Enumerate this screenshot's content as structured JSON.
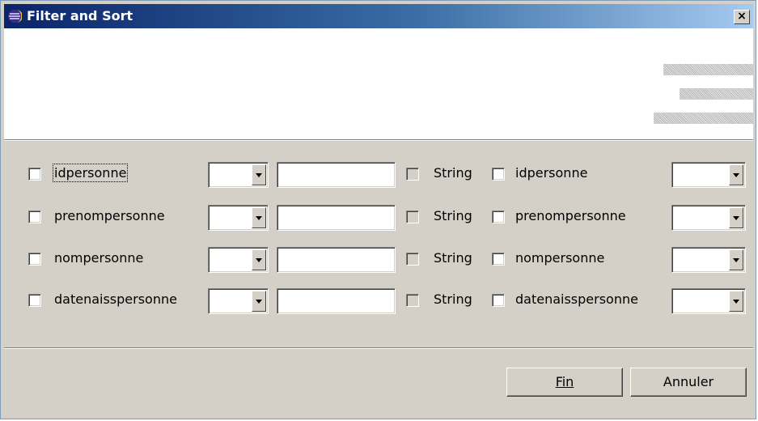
{
  "window": {
    "title": "Filter and Sort",
    "close_glyph": "×"
  },
  "rows": [
    {
      "left_label": "idpersonne",
      "type_label": "String",
      "right_label": "idpersonne"
    },
    {
      "left_label": "prenompersonne",
      "type_label": "String",
      "right_label": "prenompersonne"
    },
    {
      "left_label": "nompersonne",
      "type_label": "String",
      "right_label": "nompersonne"
    },
    {
      "left_label": "datenaisspersonne",
      "type_label": "String",
      "right_label": "datenaisspersonne"
    }
  ],
  "buttons": {
    "finish_label": "Fin",
    "cancel_label": "Annuler"
  },
  "icons": {
    "app": "eclipse-icon",
    "close": "close-icon",
    "dropdown": "chevron-down-icon"
  }
}
